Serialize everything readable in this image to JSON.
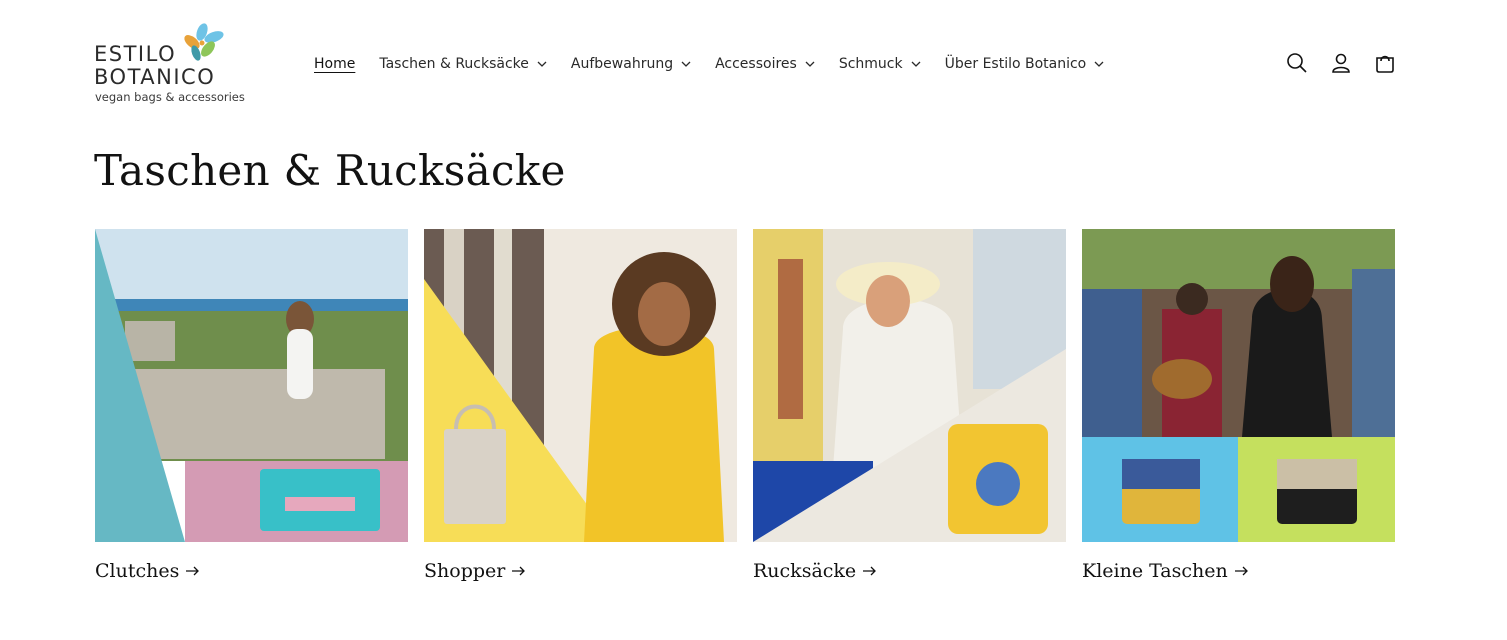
{
  "brand": {
    "line1": "ESTILO",
    "line2": "BOTANICO",
    "tagline": "vegan bags & accessories",
    "colors": {
      "petal_orange": "#e8a23a",
      "petal_blue": "#6ec3e6",
      "petal_teal": "#3f9aa8",
      "petal_green": "#8ec65a"
    }
  },
  "nav": {
    "items": [
      {
        "label": "Home",
        "active": true,
        "dropdown": false
      },
      {
        "label": "Taschen & Rucksäcke",
        "active": false,
        "dropdown": true
      },
      {
        "label": "Aufbewahrung",
        "active": false,
        "dropdown": true
      },
      {
        "label": "Accessoires",
        "active": false,
        "dropdown": true
      },
      {
        "label": "Schmuck",
        "active": false,
        "dropdown": true
      },
      {
        "label": "Über Estilo Botanico",
        "active": false,
        "dropdown": true
      }
    ]
  },
  "header_icons": [
    "search-icon",
    "account-icon",
    "cart-icon"
  ],
  "page": {
    "title": "Taschen & Rucksäcke"
  },
  "collections": [
    {
      "label": "Clutches",
      "arrow": "→"
    },
    {
      "label": "Shopper",
      "arrow": "→"
    },
    {
      "label": "Rucksäcke",
      "arrow": "→"
    },
    {
      "label": "Kleine Taschen",
      "arrow": "→"
    }
  ],
  "colors": {
    "text": "#121212",
    "background": "#ffffff"
  }
}
